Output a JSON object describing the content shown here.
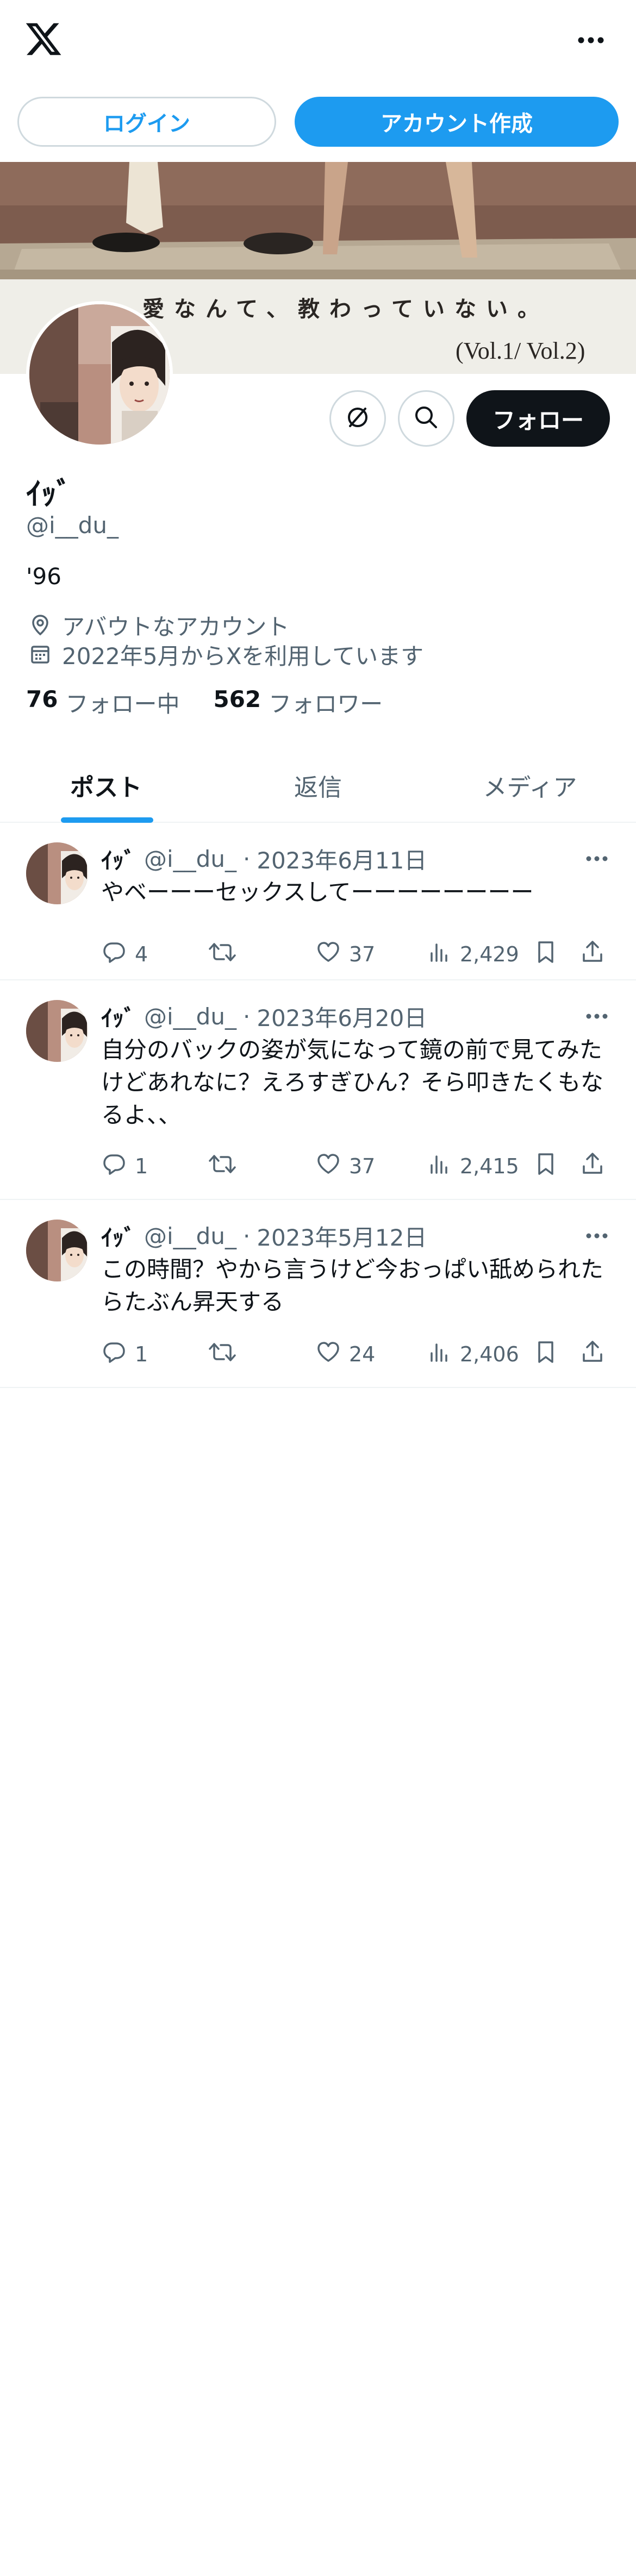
{
  "header": {
    "logo_icon": "x-logo-icon",
    "more_icon": "more-horizontal-icon"
  },
  "auth": {
    "login_label": "ログイン",
    "signup_label": "アカウント作成"
  },
  "banner": {
    "caption": "愛なんて、教わっていない。",
    "volume": "(Vol.1/ Vol.2)"
  },
  "profile": {
    "name": "ｲｯﾞ",
    "handle": "@i__du_",
    "bio": "'96",
    "location": "アバウトなアカウント",
    "joined": "2022年5月からXを利用しています",
    "following_count": "76",
    "following_label": "フォロー中",
    "followers_count": "562",
    "followers_label": "フォロワー",
    "follow_button": "フォロー"
  },
  "tabs": [
    {
      "label": "ポスト",
      "active": true
    },
    {
      "label": "返信",
      "active": false
    },
    {
      "label": "メディア",
      "active": false
    }
  ],
  "tweets": [
    {
      "name": "ｲｯﾞ",
      "handle": "@i__du_",
      "date": "2023年6月11日",
      "text": "やベーーーセックスしてーーーーーーーー",
      "replies": "4",
      "likes": "37",
      "views": "2,429"
    },
    {
      "name": "ｲｯﾞ",
      "handle": "@i__du_",
      "date": "2023年6月20日",
      "text": "自分のバックの姿が気になって鏡の前で見てみたけどあれなに？えろすぎひん？そら叩きたくもなるよ、、",
      "replies": "1",
      "likes": "37",
      "views": "2,415"
    },
    {
      "name": "ｲｯﾞ",
      "handle": "@i__du_",
      "date": "2023年5月12日",
      "text": "この時間？やから言うけど今おっぱい舐められたらたぶん昇天する",
      "replies": "1",
      "likes": "24",
      "views": "2,406"
    }
  ],
  "colors": {
    "accent": "#1d9bf0",
    "text": "#0f1419",
    "secondary": "#536471",
    "border": "#cfd9de"
  }
}
